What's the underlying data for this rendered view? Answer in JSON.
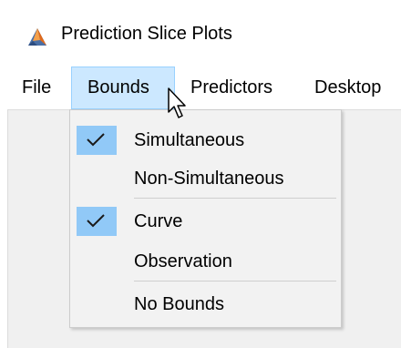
{
  "window": {
    "title": "Prediction Slice Plots",
    "icon": "matlab-icon"
  },
  "menubar": {
    "items": [
      {
        "label": "File",
        "active": false
      },
      {
        "label": "Bounds",
        "active": true
      },
      {
        "label": "Predictors",
        "active": false
      },
      {
        "label": "Desktop",
        "active": false
      }
    ]
  },
  "dropdown": {
    "items": [
      {
        "label": "Simultaneous",
        "checked": true
      },
      {
        "label": "Non-Simultaneous",
        "checked": false
      },
      {
        "label": "Curve",
        "checked": true
      },
      {
        "label": "Observation",
        "checked": false
      },
      {
        "label": "No Bounds",
        "checked": false
      }
    ]
  },
  "colors": {
    "menu_active_bg": "#cce8ff",
    "check_bg": "#91c9f7",
    "dropdown_bg": "#f2f2f2"
  }
}
